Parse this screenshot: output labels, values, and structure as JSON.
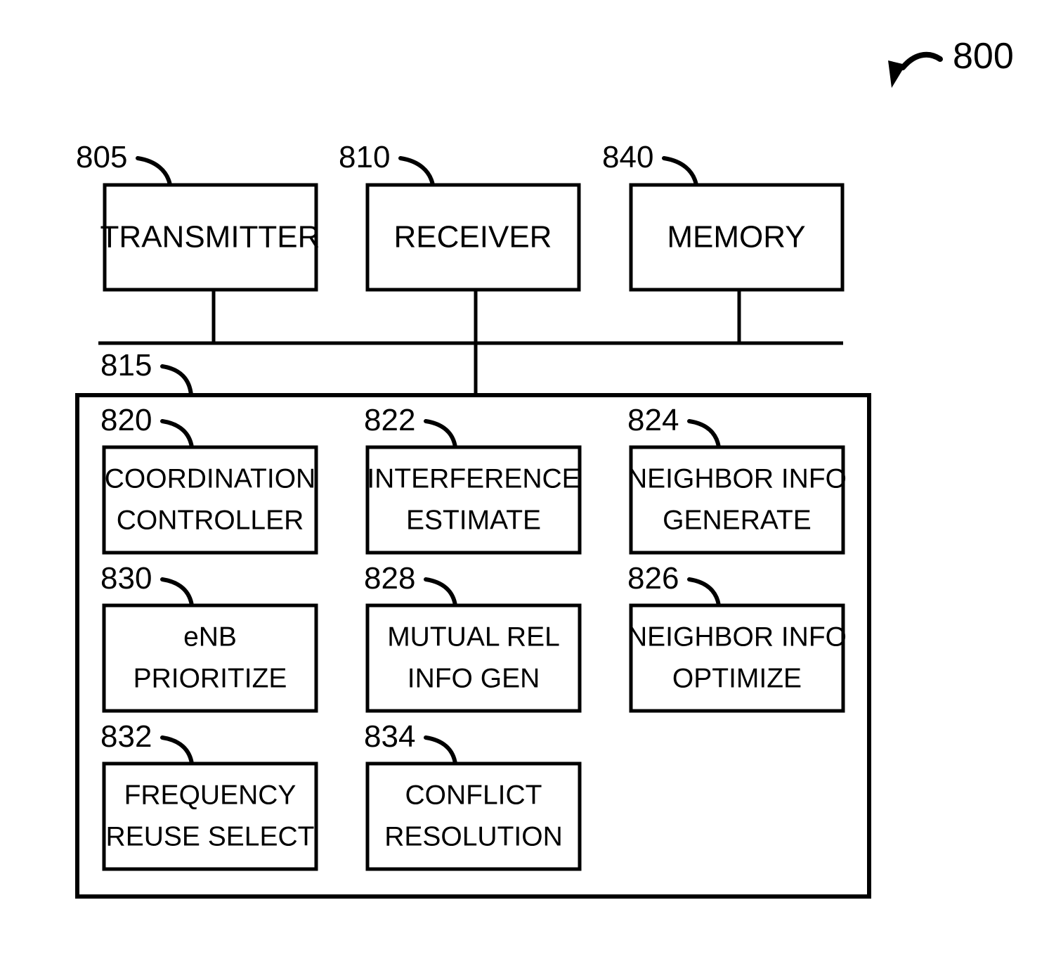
{
  "figure": {
    "number": "800",
    "type": "patent-block-diagram",
    "title_label": "800"
  },
  "top_modules": [
    {
      "ref": "805",
      "label": "TRANSMITTER"
    },
    {
      "ref": "810",
      "label": "RECEIVER"
    },
    {
      "ref": "840",
      "label": "MEMORY"
    }
  ],
  "bus": {
    "ref": "815"
  },
  "processor_modules": [
    {
      "ref": "820",
      "line1": "COORDINATION",
      "line2": "CONTROLLER"
    },
    {
      "ref": "822",
      "line1": "INTERFERENCE",
      "line2": "ESTIMATE"
    },
    {
      "ref": "824",
      "line1": "NEIGHBOR INFO",
      "line2": "GENERATE"
    },
    {
      "ref": "830",
      "line1": "eNB",
      "line2": "PRIORITIZE"
    },
    {
      "ref": "828",
      "line1": "MUTUAL REL",
      "line2": "INFO GEN"
    },
    {
      "ref": "826",
      "line1": "NEIGHBOR INFO",
      "line2": "OPTIMIZE"
    },
    {
      "ref": "832",
      "line1": "FREQUENCY",
      "line2": "REUSE SELECT"
    },
    {
      "ref": "834",
      "line1": "CONFLICT",
      "line2": "RESOLUTION"
    }
  ],
  "colors": {
    "ink": "#000000",
    "paper": "#ffffff"
  }
}
